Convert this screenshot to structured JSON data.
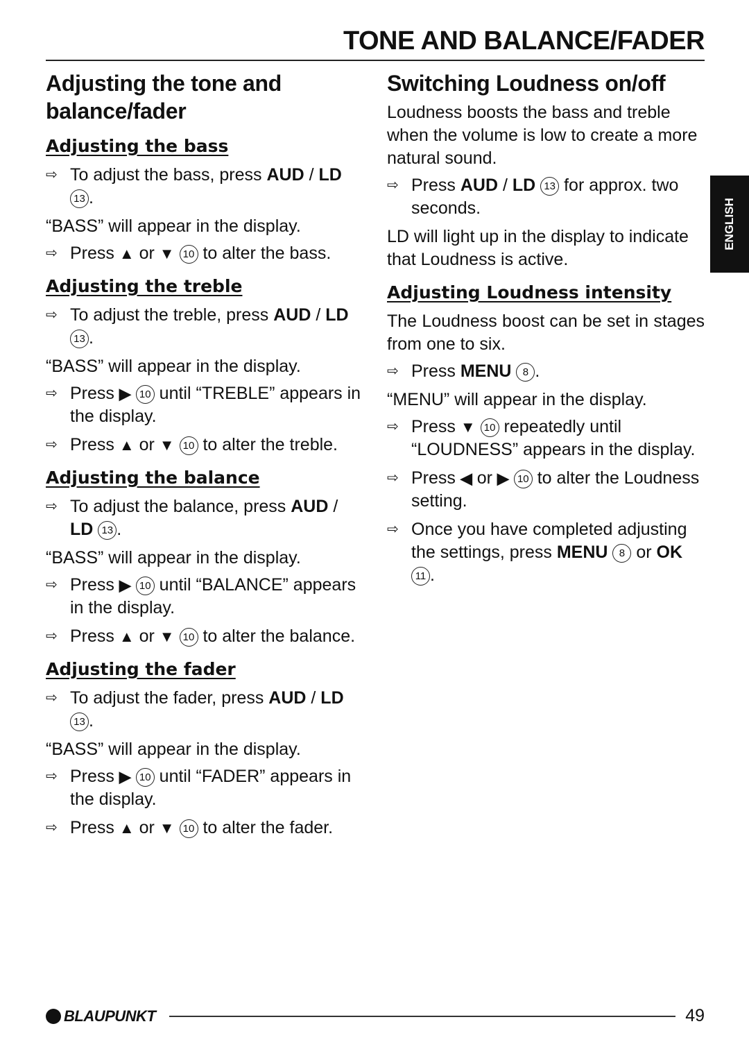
{
  "header": {
    "title": "TONE AND BALANCE/FADER"
  },
  "language_tab": "ENGLISH",
  "left": {
    "heading": "Adjusting the tone and balance/fader",
    "sections": [
      {
        "subheading": "Adjusting the bass",
        "items": [
          {
            "type": "step",
            "parts": [
              [
                "t",
                "To adjust the bass, press "
              ],
              [
                "b",
                "AUD"
              ],
              [
                "t",
                " / "
              ],
              [
                "b",
                "LD"
              ],
              [
                "t",
                " "
              ],
              [
                "c",
                "13"
              ],
              [
                "t",
                "."
              ]
            ]
          },
          {
            "type": "para",
            "parts": [
              [
                "t",
                "“BASS” will appear in the display."
              ]
            ]
          },
          {
            "type": "step",
            "parts": [
              [
                "t",
                "Press "
              ],
              [
                "g",
                "▲"
              ],
              [
                "t",
                " or "
              ],
              [
                "g",
                "▼"
              ],
              [
                "t",
                " "
              ],
              [
                "c",
                "10"
              ],
              [
                "t",
                " to alter the bass."
              ]
            ]
          }
        ]
      },
      {
        "subheading": "Adjusting the treble",
        "items": [
          {
            "type": "step",
            "parts": [
              [
                "t",
                "To adjust the treble, press "
              ],
              [
                "b",
                "AUD"
              ],
              [
                "t",
                " / "
              ],
              [
                "b",
                "LD"
              ],
              [
                "t",
                " "
              ],
              [
                "c",
                "13"
              ],
              [
                "t",
                "."
              ]
            ]
          },
          {
            "type": "para",
            "parts": [
              [
                "t",
                "“BASS” will appear in the display."
              ]
            ]
          },
          {
            "type": "step",
            "parts": [
              [
                "t",
                "Press "
              ],
              [
                "g",
                "▶"
              ],
              [
                "t",
                " "
              ],
              [
                "c",
                "10"
              ],
              [
                "t",
                " until “TREBLE” appears in the display."
              ]
            ]
          },
          {
            "type": "step",
            "parts": [
              [
                "t",
                "Press "
              ],
              [
                "g",
                "▲"
              ],
              [
                "t",
                " or "
              ],
              [
                "g",
                "▼"
              ],
              [
                "t",
                " "
              ],
              [
                "c",
                "10"
              ],
              [
                "t",
                " to alter the treble."
              ]
            ]
          }
        ]
      },
      {
        "subheading": "Adjusting the balance",
        "items": [
          {
            "type": "step",
            "parts": [
              [
                "t",
                "To adjust the balance, press "
              ],
              [
                "b",
                "AUD"
              ],
              [
                "t",
                " / "
              ],
              [
                "b",
                "LD"
              ],
              [
                "t",
                " "
              ],
              [
                "c",
                "13"
              ],
              [
                "t",
                "."
              ]
            ]
          },
          {
            "type": "para",
            "parts": [
              [
                "t",
                "“BASS” will appear in the display."
              ]
            ]
          },
          {
            "type": "step",
            "parts": [
              [
                "t",
                "Press "
              ],
              [
                "g",
                "▶"
              ],
              [
                "t",
                " "
              ],
              [
                "c",
                "10"
              ],
              [
                "t",
                " until “BALANCE” appears in the display."
              ]
            ]
          },
          {
            "type": "step",
            "parts": [
              [
                "t",
                "Press "
              ],
              [
                "g",
                "▲"
              ],
              [
                "t",
                " or "
              ],
              [
                "g",
                "▼"
              ],
              [
                "t",
                " "
              ],
              [
                "c",
                "10"
              ],
              [
                "t",
                " to alter the balance."
              ]
            ]
          }
        ]
      },
      {
        "subheading": "Adjusting the fader",
        "items": [
          {
            "type": "step",
            "parts": [
              [
                "t",
                "To adjust the fader, press "
              ],
              [
                "b",
                "AUD"
              ],
              [
                "t",
                " / "
              ],
              [
                "b",
                "LD"
              ],
              [
                "t",
                " "
              ],
              [
                "c",
                "13"
              ],
              [
                "t",
                "."
              ]
            ]
          },
          {
            "type": "para",
            "parts": [
              [
                "t",
                "“BASS” will appear in the display."
              ]
            ]
          },
          {
            "type": "step",
            "parts": [
              [
                "t",
                "Press "
              ],
              [
                "g",
                "▶"
              ],
              [
                "t",
                " "
              ],
              [
                "c",
                "10"
              ],
              [
                "t",
                " until “FADER” appears in the display."
              ]
            ]
          },
          {
            "type": "step",
            "parts": [
              [
                "t",
                "Press "
              ],
              [
                "g",
                "▲"
              ],
              [
                "t",
                " or "
              ],
              [
                "g",
                "▼"
              ],
              [
                "t",
                " "
              ],
              [
                "c",
                "10"
              ],
              [
                "t",
                " to alter the fader."
              ]
            ]
          }
        ]
      }
    ]
  },
  "right": {
    "heading": "Switching Loudness on/off",
    "intro": [
      {
        "type": "para",
        "parts": [
          [
            "t",
            "Loudness boosts the bass and treble when the volume is low to create a more natural sound."
          ]
        ]
      },
      {
        "type": "step",
        "parts": [
          [
            "t",
            "Press "
          ],
          [
            "b",
            "AUD"
          ],
          [
            "t",
            " / "
          ],
          [
            "b",
            "LD"
          ],
          [
            "t",
            " "
          ],
          [
            "c",
            "13"
          ],
          [
            "t",
            " for approx. two seconds."
          ]
        ]
      },
      {
        "type": "para",
        "parts": [
          [
            "t",
            "LD will light up in the display to indicate that Loudness is active."
          ]
        ]
      }
    ],
    "sections": [
      {
        "subheading": "Adjusting Loudness intensity",
        "items": [
          {
            "type": "para",
            "parts": [
              [
                "t",
                "The Loudness boost can be set in stages from one to six."
              ]
            ]
          },
          {
            "type": "step",
            "parts": [
              [
                "t",
                "Press "
              ],
              [
                "b",
                "MENU"
              ],
              [
                "t",
                " "
              ],
              [
                "c",
                "8"
              ],
              [
                "t",
                "."
              ]
            ]
          },
          {
            "type": "para",
            "parts": [
              [
                "t",
                "“MENU” will appear in the display."
              ]
            ]
          },
          {
            "type": "step",
            "parts": [
              [
                "t",
                "Press "
              ],
              [
                "g",
                "▼"
              ],
              [
                "t",
                " "
              ],
              [
                "c",
                "10"
              ],
              [
                "t",
                " repeatedly until “LOUDNESS” appears in the display."
              ]
            ]
          },
          {
            "type": "step",
            "parts": [
              [
                "t",
                "Press "
              ],
              [
                "g",
                "◀"
              ],
              [
                "t",
                " or "
              ],
              [
                "g",
                "▶"
              ],
              [
                "t",
                " "
              ],
              [
                "c",
                "10"
              ],
              [
                "t",
                " to alter the Loudness setting."
              ]
            ]
          },
          {
            "type": "step",
            "parts": [
              [
                "t",
                "Once you have completed adjusting the settings, press "
              ],
              [
                "b",
                "MENU"
              ],
              [
                "t",
                " "
              ],
              [
                "c",
                "8"
              ],
              [
                "t",
                " or "
              ],
              [
                "b",
                "OK"
              ],
              [
                "t",
                " "
              ],
              [
                "c",
                "11"
              ],
              [
                "t",
                "."
              ]
            ]
          }
        ]
      }
    ]
  },
  "footer": {
    "brand": "BLAUPUNKT",
    "page_number": "49"
  },
  "icons": {
    "step_arrow": "⇨"
  }
}
